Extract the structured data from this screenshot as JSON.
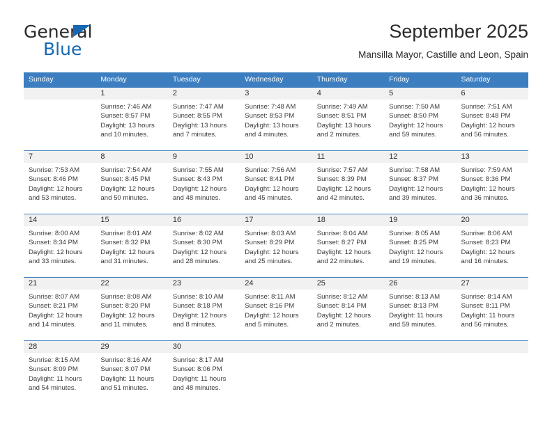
{
  "logo": {
    "word_top": "General",
    "word_bottom": "Blue",
    "triangle_color": "#1668b3"
  },
  "header": {
    "title": "September 2025",
    "subtitle": "Mansilla Mayor, Castille and Leon, Spain"
  },
  "theme": {
    "header_blue": "#3c7ebf",
    "daynum_band": "#f1f1f1",
    "text": "#2b2b2b"
  },
  "weekdays": [
    "Sunday",
    "Monday",
    "Tuesday",
    "Wednesday",
    "Thursday",
    "Friday",
    "Saturday"
  ],
  "weeks": [
    [
      {
        "day": "",
        "sunrise": "",
        "sunset": "",
        "daylight_line1": "",
        "daylight_line2": ""
      },
      {
        "day": "1",
        "sunrise": "Sunrise: 7:46 AM",
        "sunset": "Sunset: 8:57 PM",
        "daylight_line1": "Daylight: 13 hours",
        "daylight_line2": "and 10 minutes."
      },
      {
        "day": "2",
        "sunrise": "Sunrise: 7:47 AM",
        "sunset": "Sunset: 8:55 PM",
        "daylight_line1": "Daylight: 13 hours",
        "daylight_line2": "and 7 minutes."
      },
      {
        "day": "3",
        "sunrise": "Sunrise: 7:48 AM",
        "sunset": "Sunset: 8:53 PM",
        "daylight_line1": "Daylight: 13 hours",
        "daylight_line2": "and 4 minutes."
      },
      {
        "day": "4",
        "sunrise": "Sunrise: 7:49 AM",
        "sunset": "Sunset: 8:51 PM",
        "daylight_line1": "Daylight: 13 hours",
        "daylight_line2": "and 2 minutes."
      },
      {
        "day": "5",
        "sunrise": "Sunrise: 7:50 AM",
        "sunset": "Sunset: 8:50 PM",
        "daylight_line1": "Daylight: 12 hours",
        "daylight_line2": "and 59 minutes."
      },
      {
        "day": "6",
        "sunrise": "Sunrise: 7:51 AM",
        "sunset": "Sunset: 8:48 PM",
        "daylight_line1": "Daylight: 12 hours",
        "daylight_line2": "and 56 minutes."
      }
    ],
    [
      {
        "day": "7",
        "sunrise": "Sunrise: 7:53 AM",
        "sunset": "Sunset: 8:46 PM",
        "daylight_line1": "Daylight: 12 hours",
        "daylight_line2": "and 53 minutes."
      },
      {
        "day": "8",
        "sunrise": "Sunrise: 7:54 AM",
        "sunset": "Sunset: 8:45 PM",
        "daylight_line1": "Daylight: 12 hours",
        "daylight_line2": "and 50 minutes."
      },
      {
        "day": "9",
        "sunrise": "Sunrise: 7:55 AM",
        "sunset": "Sunset: 8:43 PM",
        "daylight_line1": "Daylight: 12 hours",
        "daylight_line2": "and 48 minutes."
      },
      {
        "day": "10",
        "sunrise": "Sunrise: 7:56 AM",
        "sunset": "Sunset: 8:41 PM",
        "daylight_line1": "Daylight: 12 hours",
        "daylight_line2": "and 45 minutes."
      },
      {
        "day": "11",
        "sunrise": "Sunrise: 7:57 AM",
        "sunset": "Sunset: 8:39 PM",
        "daylight_line1": "Daylight: 12 hours",
        "daylight_line2": "and 42 minutes."
      },
      {
        "day": "12",
        "sunrise": "Sunrise: 7:58 AM",
        "sunset": "Sunset: 8:37 PM",
        "daylight_line1": "Daylight: 12 hours",
        "daylight_line2": "and 39 minutes."
      },
      {
        "day": "13",
        "sunrise": "Sunrise: 7:59 AM",
        "sunset": "Sunset: 8:36 PM",
        "daylight_line1": "Daylight: 12 hours",
        "daylight_line2": "and 36 minutes."
      }
    ],
    [
      {
        "day": "14",
        "sunrise": "Sunrise: 8:00 AM",
        "sunset": "Sunset: 8:34 PM",
        "daylight_line1": "Daylight: 12 hours",
        "daylight_line2": "and 33 minutes."
      },
      {
        "day": "15",
        "sunrise": "Sunrise: 8:01 AM",
        "sunset": "Sunset: 8:32 PM",
        "daylight_line1": "Daylight: 12 hours",
        "daylight_line2": "and 31 minutes."
      },
      {
        "day": "16",
        "sunrise": "Sunrise: 8:02 AM",
        "sunset": "Sunset: 8:30 PM",
        "daylight_line1": "Daylight: 12 hours",
        "daylight_line2": "and 28 minutes."
      },
      {
        "day": "17",
        "sunrise": "Sunrise: 8:03 AM",
        "sunset": "Sunset: 8:29 PM",
        "daylight_line1": "Daylight: 12 hours",
        "daylight_line2": "and 25 minutes."
      },
      {
        "day": "18",
        "sunrise": "Sunrise: 8:04 AM",
        "sunset": "Sunset: 8:27 PM",
        "daylight_line1": "Daylight: 12 hours",
        "daylight_line2": "and 22 minutes."
      },
      {
        "day": "19",
        "sunrise": "Sunrise: 8:05 AM",
        "sunset": "Sunset: 8:25 PM",
        "daylight_line1": "Daylight: 12 hours",
        "daylight_line2": "and 19 minutes."
      },
      {
        "day": "20",
        "sunrise": "Sunrise: 8:06 AM",
        "sunset": "Sunset: 8:23 PM",
        "daylight_line1": "Daylight: 12 hours",
        "daylight_line2": "and 16 minutes."
      }
    ],
    [
      {
        "day": "21",
        "sunrise": "Sunrise: 8:07 AM",
        "sunset": "Sunset: 8:21 PM",
        "daylight_line1": "Daylight: 12 hours",
        "daylight_line2": "and 14 minutes."
      },
      {
        "day": "22",
        "sunrise": "Sunrise: 8:08 AM",
        "sunset": "Sunset: 8:20 PM",
        "daylight_line1": "Daylight: 12 hours",
        "daylight_line2": "and 11 minutes."
      },
      {
        "day": "23",
        "sunrise": "Sunrise: 8:10 AM",
        "sunset": "Sunset: 8:18 PM",
        "daylight_line1": "Daylight: 12 hours",
        "daylight_line2": "and 8 minutes."
      },
      {
        "day": "24",
        "sunrise": "Sunrise: 8:11 AM",
        "sunset": "Sunset: 8:16 PM",
        "daylight_line1": "Daylight: 12 hours",
        "daylight_line2": "and 5 minutes."
      },
      {
        "day": "25",
        "sunrise": "Sunrise: 8:12 AM",
        "sunset": "Sunset: 8:14 PM",
        "daylight_line1": "Daylight: 12 hours",
        "daylight_line2": "and 2 minutes."
      },
      {
        "day": "26",
        "sunrise": "Sunrise: 8:13 AM",
        "sunset": "Sunset: 8:13 PM",
        "daylight_line1": "Daylight: 11 hours",
        "daylight_line2": "and 59 minutes."
      },
      {
        "day": "27",
        "sunrise": "Sunrise: 8:14 AM",
        "sunset": "Sunset: 8:11 PM",
        "daylight_line1": "Daylight: 11 hours",
        "daylight_line2": "and 56 minutes."
      }
    ],
    [
      {
        "day": "28",
        "sunrise": "Sunrise: 8:15 AM",
        "sunset": "Sunset: 8:09 PM",
        "daylight_line1": "Daylight: 11 hours",
        "daylight_line2": "and 54 minutes."
      },
      {
        "day": "29",
        "sunrise": "Sunrise: 8:16 AM",
        "sunset": "Sunset: 8:07 PM",
        "daylight_line1": "Daylight: 11 hours",
        "daylight_line2": "and 51 minutes."
      },
      {
        "day": "30",
        "sunrise": "Sunrise: 8:17 AM",
        "sunset": "Sunset: 8:06 PM",
        "daylight_line1": "Daylight: 11 hours",
        "daylight_line2": "and 48 minutes."
      },
      {
        "day": "",
        "sunrise": "",
        "sunset": "",
        "daylight_line1": "",
        "daylight_line2": ""
      },
      {
        "day": "",
        "sunrise": "",
        "sunset": "",
        "daylight_line1": "",
        "daylight_line2": ""
      },
      {
        "day": "",
        "sunrise": "",
        "sunset": "",
        "daylight_line1": "",
        "daylight_line2": ""
      },
      {
        "day": "",
        "sunrise": "",
        "sunset": "",
        "daylight_line1": "",
        "daylight_line2": ""
      }
    ]
  ]
}
